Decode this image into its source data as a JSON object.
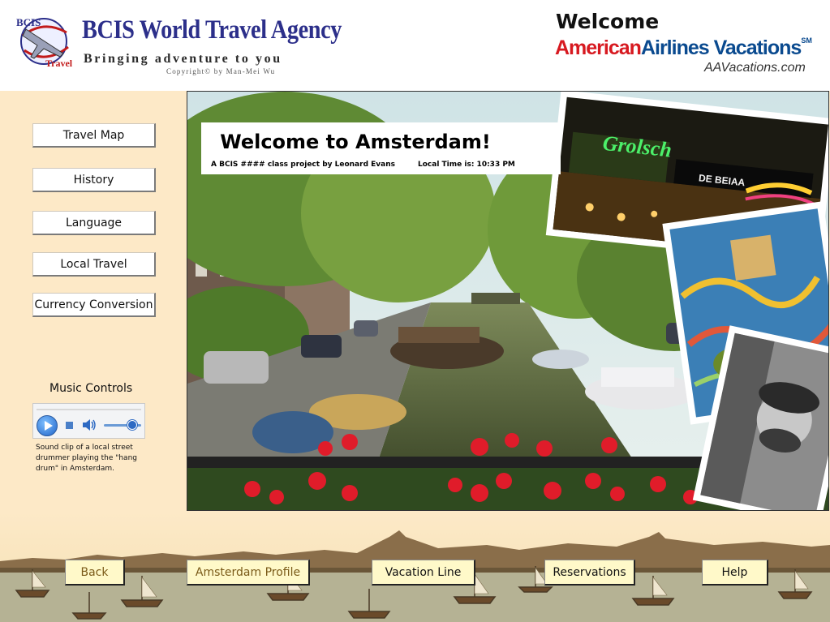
{
  "header": {
    "agency_title": "BCIS World Travel Agency",
    "tagline": "Bringing adventure to you",
    "copyright": "Copyright© by Man-Mei Wu",
    "logo_text": "BCIS Travel",
    "welcome": "Welcome",
    "aa_part1": "American",
    "aa_part2": "Airlines Vacations",
    "aa_mark": "SM",
    "aa_url": "AAVacations.com"
  },
  "sidebar": {
    "items": [
      {
        "label": "Travel Map"
      },
      {
        "label": "History"
      },
      {
        "label": "Language"
      },
      {
        "label": "Local Travel"
      },
      {
        "label": "Currency Conversion"
      }
    ]
  },
  "music": {
    "title": "Music Controls",
    "volume_level": 0.75,
    "caption": "Sound clip of a local street drummer playing the \"hang drum\" in Amsterdam."
  },
  "main": {
    "title": "Welcome to Amsterdam!",
    "subtitle": "A BCIS #### class project by Leonard Evans",
    "local_time": "Local Time is:  10:33 PM",
    "sign_text": "Grolsch",
    "sign_text2": "DE BEIAA"
  },
  "footer": {
    "buttons": [
      {
        "label": "Back"
      },
      {
        "label": "Amsterdam Profile"
      },
      {
        "label": "Vacation Line"
      },
      {
        "label": "Reservations"
      },
      {
        "label": "Help"
      }
    ]
  },
  "colors": {
    "page_bg": "#fde9c7",
    "brand_blue": "#2c2f8a",
    "aa_red": "#d71920",
    "aa_blue": "#0a4a8f",
    "footer_button_bg": "#fff9c9"
  }
}
